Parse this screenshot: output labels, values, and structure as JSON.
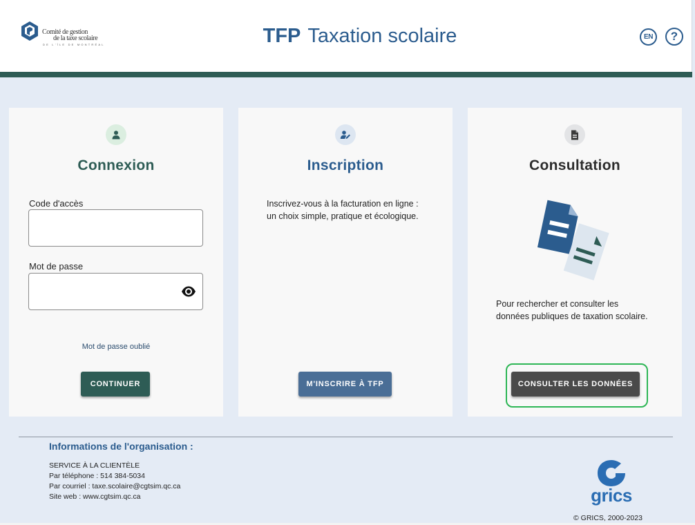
{
  "header": {
    "logo_line1": "Comité de gestion",
    "logo_line2": "de la taxe scolaire",
    "logo_line3": "DE L'ÎLE DE MONTRÉAL",
    "app_short": "TFP",
    "app_name": "Taxation scolaire",
    "lang_label": "EN",
    "help_label": "?"
  },
  "login": {
    "title": "Connexion",
    "code_label": "Code d'accès",
    "code_value": "",
    "password_label": "Mot de passe",
    "password_value": "",
    "forgot_label": "Mot de passe oublié",
    "continue_label": "CONTINUER"
  },
  "signup": {
    "title": "Inscription",
    "desc_line1": "Inscrivez-vous à la facturation en ligne :",
    "desc_line2": "un choix simple, pratique et écologique.",
    "button_label": "M'INSCRIRE À TFP"
  },
  "consult": {
    "title": "Consultation",
    "desc_line1": "Pour rechercher et consulter les",
    "desc_line2": "données publiques de taxation scolaire.",
    "button_label": "CONSULTER LES DONNÉES"
  },
  "footer": {
    "org_title": "Informations de l'organisation :",
    "service": "SERVICE À LA CLIENTÈLE",
    "phone": "Par téléphone : 514 384-5034",
    "email": "Par courriel : taxe.scolaire@cgtsim.qc.ca",
    "web": "Site web : www.cgtsim.qc.ca",
    "brand": "grics",
    "copyright": "© GRICS, 2000-2023"
  },
  "colors": {
    "primary_blue": "#2b5c8e",
    "dark_teal": "#2e5c55",
    "button_blue": "#4a6e96",
    "button_dark": "#4a4a4a",
    "highlight_green": "#2db655",
    "background": "#e4ebf5"
  }
}
